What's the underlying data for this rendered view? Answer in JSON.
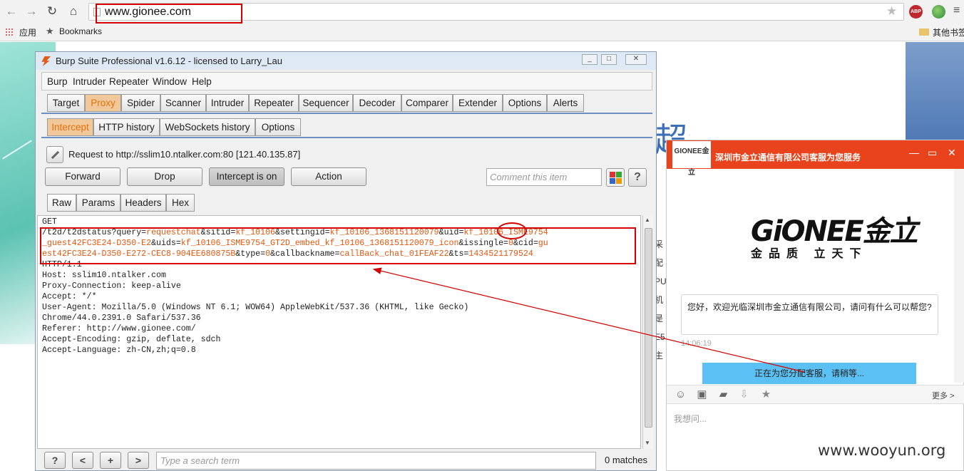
{
  "browser": {
    "url": "www.gionee.com",
    "bookmarks": [
      "应用",
      "Bookmarks",
      "其他书签"
    ],
    "ext_abp": "ABP"
  },
  "site": {
    "banner": "超级续航",
    "side_chars": [
      "采",
      "配",
      "PU",
      "机",
      "是",
      "E5",
      "主"
    ]
  },
  "burp": {
    "title": "Burp Suite Professional v1.6.12 - licensed to Larry_Lau",
    "menu": [
      "Burp",
      "Intruder",
      "Repeater",
      "Window",
      "Help"
    ],
    "main_tabs": [
      "Target",
      "Proxy",
      "Spider",
      "Scanner",
      "Intruder",
      "Repeater",
      "Sequencer",
      "Decoder",
      "Comparer",
      "Extender",
      "Options",
      "Alerts"
    ],
    "proxy_tabs": [
      "Intercept",
      "HTTP history",
      "WebSockets history",
      "Options"
    ],
    "request_line": "Request to http://sslim10.ntalker.com:80  [121.40.135.87]",
    "buttons": {
      "forward": "Forward",
      "drop": "Drop",
      "intercept": "Intercept is on",
      "action": "Action"
    },
    "comment_placeholder": "Comment this item",
    "view_tabs": [
      "Raw",
      "Params",
      "Headers",
      "Hex"
    ],
    "request": {
      "l1": "GET",
      "l2a": "/t2d/t2dstatus?query=",
      "l2b": "requestchat",
      "l2c": "&sitid=",
      "l2d": "kf_10106",
      "l2e": "&settingid=",
      "l2f": "kf_10106_1368151120079",
      "l2g": "&uid=",
      "l2h": "kf_10106_ISME9754",
      "l3a": "_guest42FC3E24-D350-E2",
      "l3b": "&uids=",
      "l3c": "kf_10106_ISME9754_GT2D_embed_kf_10106_1368151120079_icon",
      "l3d": "&issingle=",
      "l3e": "0",
      "l3f": "&cid=",
      "l3g": "gu",
      "l4a": "est42FC3E24-D350-E272-CEC8-904EE680875B",
      "l4b": "&type=",
      "l4c": "0",
      "l4d": "&callbackname=",
      "l4e": "callBack_chat_01FEAF22",
      "l4f": "&ts=",
      "l4g": "1434521179524",
      "l5": "HTTP/1.1",
      "l6": "Host: sslim10.ntalker.com",
      "l7": "Proxy-Connection: keep-alive",
      "l8": "Accept: */*",
      "l9": "User-Agent: Mozilla/5.0 (Windows NT 6.1; WOW64) AppleWebKit/537.36 (KHTML, like Gecko)",
      "l10": "Chrome/44.0.2391.0 Safari/537.36",
      "l11": "Referer: http://www.gionee.com/",
      "l12": "Accept-Encoding: gzip, deflate, sdch",
      "l13": "Accept-Language: zh-CN,zh;q=0.8"
    },
    "bottom": {
      "help": "?",
      "prev": "<",
      "add": "+",
      "next": ">"
    },
    "search_placeholder": "Type a search term",
    "matches": "0 matches"
  },
  "chat": {
    "logo": "GIONEE金立",
    "title": "深圳市金立通信有限公司客服为您服务",
    "brand": "GiONEE金立",
    "slogan": "金品质 立天下",
    "greeting": "您好，欢迎光临深圳市金立通信有限公司，请问有什么可以帮您?",
    "time": "14:06:19",
    "notice": "正在为您分配客服，请稍等...",
    "more": "更多 >",
    "input_placeholder": "我想问..."
  },
  "watermark": "www.wooyun.org",
  "colors": {
    "annotation_red": "#d40000",
    "burp_accent": "#e8700a",
    "chat_header": "#e8431c",
    "notice_bg": "#5bc0f3"
  }
}
